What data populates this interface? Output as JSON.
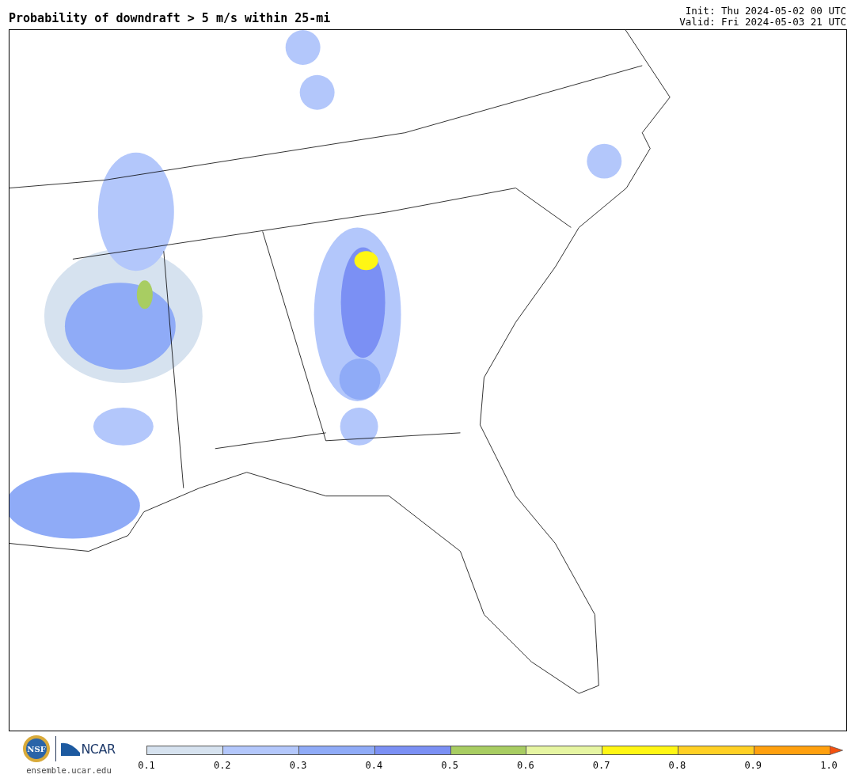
{
  "title": "Probability of downdraft > 5 m/s within 25-mi",
  "init": "Init: Thu 2024-05-02 00 UTC",
  "valid": "Valid: Fri 2024-05-03 21 UTC",
  "logos": {
    "seal_text": "NSF",
    "wordmark": "NCAR",
    "site": "ensemble.ucar.edu"
  },
  "colorbar": {
    "bins": [
      {
        "color": "#d6e2ef"
      },
      {
        "color": "#b3c7fb"
      },
      {
        "color": "#8fabf7"
      },
      {
        "color": "#7b90f4"
      },
      {
        "color": "#a8cd62"
      },
      {
        "color": "#e6f5a2"
      },
      {
        "color": "#fff614"
      },
      {
        "color": "#ffd024"
      },
      {
        "color": "#ffa00e"
      }
    ],
    "extend": {
      "color": "#f4510f"
    },
    "ticks": [
      "0.1",
      "0.2",
      "0.3",
      "0.4",
      "0.5",
      "0.6",
      "0.7",
      "0.8",
      "0.9",
      "1.0"
    ]
  }
}
